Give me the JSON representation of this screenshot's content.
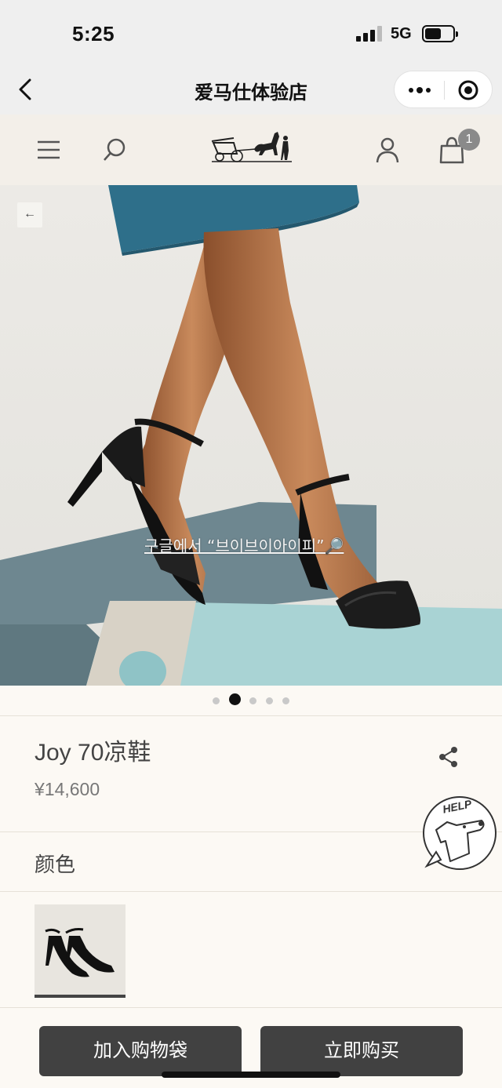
{
  "status_bar": {
    "time": "5:25",
    "network": "5G"
  },
  "nav_bar": {
    "title": "爱马仕体验店",
    "more_icon": "more-dots-icon",
    "target_icon": "target-icon"
  },
  "store_header": {
    "menu_icon": "hamburger-icon",
    "search_icon": "search-icon",
    "logo": "hermes-carriage-logo",
    "account_icon": "user-icon",
    "bag_icon": "shopping-bag-icon",
    "bag_count": "1"
  },
  "hero": {
    "back_icon": "←",
    "watermark": "구글에서 “브이브이아이피”🔎",
    "slides_total": 5,
    "active_slide": 2
  },
  "product": {
    "name": "Joy 70凉鞋",
    "price": "¥14,600",
    "share_icon": "share-icon"
  },
  "help": {
    "label": "HELP"
  },
  "color_section": {
    "label": "颜色"
  },
  "actions": {
    "add_to_bag": "加入购物袋",
    "buy_now": "立即购买"
  },
  "colors": {
    "background": "#fcf9f4",
    "header_bg": "#f3efe9",
    "button_bg": "#414141",
    "skirt": "#2e6f8a",
    "block_light": "#a9d3d4",
    "block_dark": "#6f8a92"
  }
}
